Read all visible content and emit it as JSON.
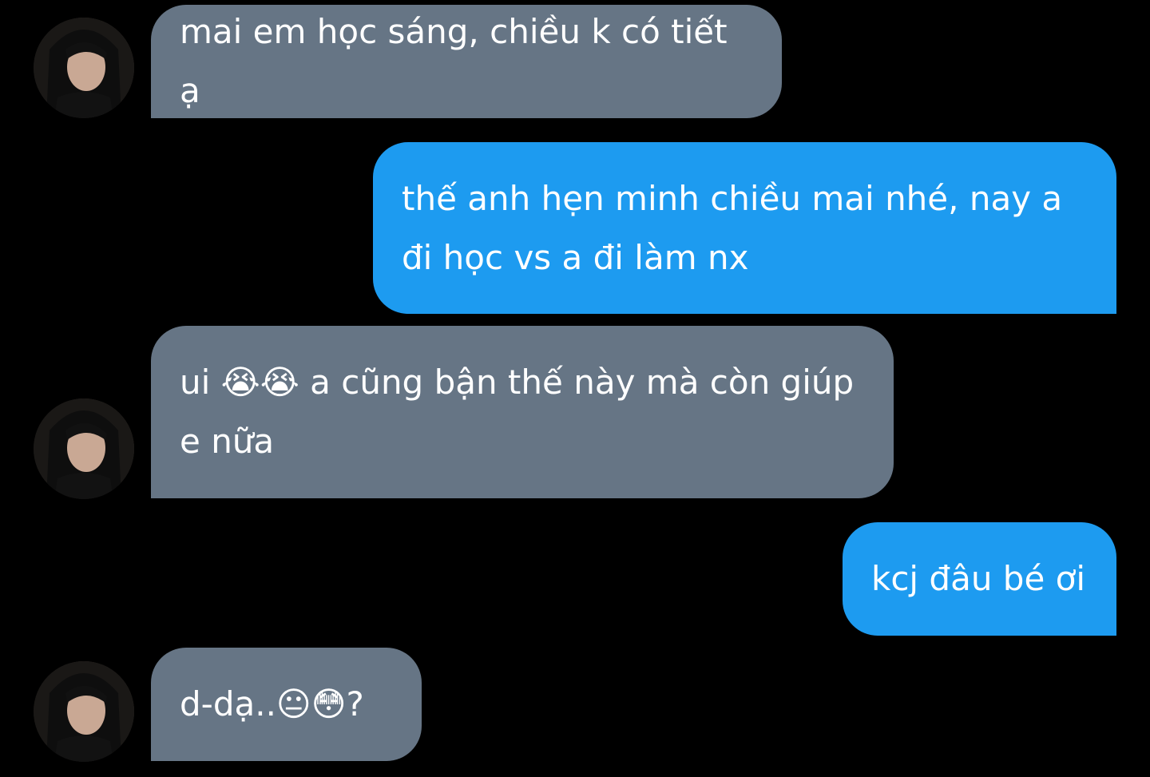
{
  "messages": [
    {
      "direction": "incoming",
      "text": "mai em học sáng, chiều k có tiết ạ"
    },
    {
      "direction": "outgoing",
      "text": "thế anh hẹn minh chiều mai nhé, nay a\nđi học vs a đi làm nx"
    },
    {
      "direction": "incoming",
      "text": "ui 😭😭 a cũng bận thế này mà còn giúp\ne nữa"
    },
    {
      "direction": "outgoing",
      "text": "kcj đâu bé ơi"
    },
    {
      "direction": "incoming",
      "text": "d-dạ..😐😳?"
    }
  ],
  "colors": {
    "background": "#000000",
    "incoming_bubble": "#667585",
    "outgoing_bubble": "#1d9bf0",
    "text": "#ffffff"
  }
}
